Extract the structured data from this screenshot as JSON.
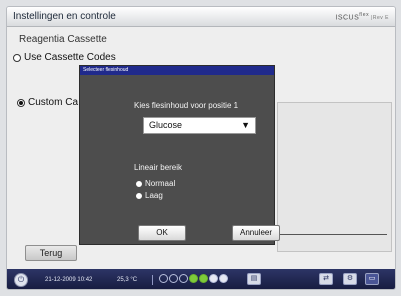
{
  "header": {
    "title": "Instellingen en controle",
    "brand": "ISCUS",
    "brand_sup": "flex",
    "rev": "|Rev E"
  },
  "section": {
    "title": "Reagentia Cassette"
  },
  "options": {
    "use_cassette": "Use Cassette Codes",
    "custom": "Custom Ca"
  },
  "buttons": {
    "terug": "Terug"
  },
  "modal": {
    "title": "Selecteer flesinhoud",
    "prompt": "Kies flesinhoud voor positie 1",
    "selected": "Glucose",
    "range_label": "Lineair bereik",
    "range_options": [
      "Normaal",
      "Laag"
    ],
    "range_selected": "Normaal",
    "ok": "OK",
    "cancel": "Annuleer"
  },
  "status": {
    "datetime": "21-12-2009 10:42",
    "temperature": "25,3 °C",
    "pods": [
      "empty",
      "empty",
      "empty",
      "green",
      "green",
      "white",
      "white"
    ],
    "icons": [
      "sample-icon",
      "gear-icon",
      "monitor-icon"
    ]
  }
}
